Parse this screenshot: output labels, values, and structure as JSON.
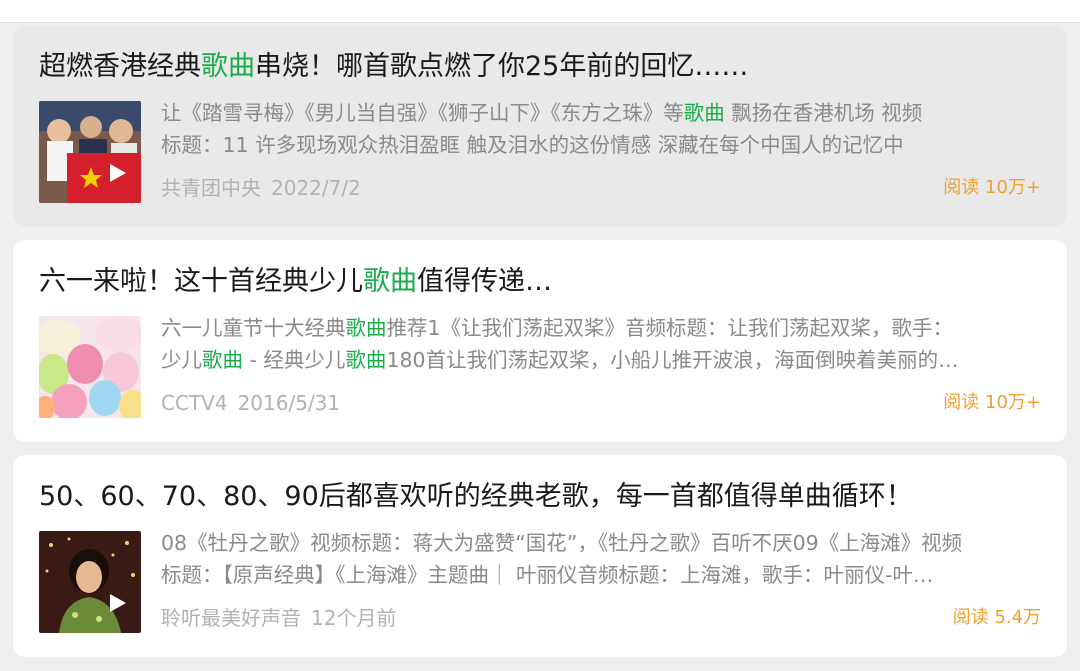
{
  "cards": [
    {
      "title_parts": [
        "超燃香港经典",
        "歌曲",
        "串烧！哪首歌点燃了你25年前的回忆……"
      ],
      "summary_line1_parts": [
        "让《踏雪寻梅》《男儿当自强》《狮子山下》《东方之珠》等",
        "歌曲",
        " 飘扬在香港机场 视频"
      ],
      "summary_line2": "标题：11 许多现场观众热泪盈眶 触及泪水的这份情感 深藏在每个中国人的记忆中",
      "source": "共青团中央",
      "date": "2022/7/2",
      "reads": "阅读 10万+",
      "thumb_icon": "flag-crowd-video-thumbnail",
      "has_play": true
    },
    {
      "title_parts": [
        "六一来啦！这十首经典少儿",
        "歌曲",
        "值得传递…"
      ],
      "summary_line1_parts": [
        "六一儿童节十大经典",
        "歌曲",
        "推荐1《让我们荡起双桨》音频标题：让我们荡起双桨，歌手："
      ],
      "summary_line2_parts": [
        "少儿",
        "歌曲",
        " - 经典少儿",
        "歌曲",
        "180首让我们荡起双桨，小船儿推开波浪，海面倒映着美丽的…"
      ],
      "source": "CCTV4",
      "date": "2016/5/31",
      "reads": "阅读 10万+",
      "thumb_icon": "balloons-thumbnail",
      "has_play": false
    },
    {
      "title": "50、60、70、80、90后都喜欢听的经典老歌，每一首都值得单曲循环！",
      "summary_line1": "08《牡丹之歌》视频标题：蒋大为盛赞“国花”，《牡丹之歌》百听不厌09《上海滩》视频",
      "summary_line2": "标题：【原声经典】《上海滩》主题曲｜ 叶丽仪音频标题：上海滩，歌手：叶丽仪-叶…",
      "source": "聆听最美好声音",
      "date": "12个月前",
      "reads": "阅读 5.4万",
      "thumb_icon": "singer-video-thumbnail",
      "has_play": true
    }
  ],
  "colors": {
    "highlight": "#1aad4b",
    "reads": "#f0a030",
    "meta": "#b2b2b2",
    "summary": "#8a8a8a"
  }
}
